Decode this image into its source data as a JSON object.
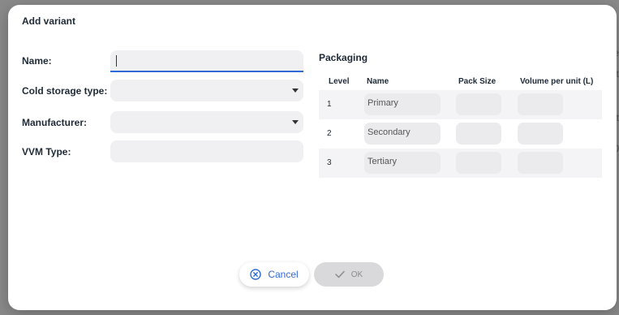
{
  "backdrop": {
    "right_fragments": [
      "e",
      "t",
      "st",
      "10"
    ]
  },
  "dialog": {
    "title": "Add variant"
  },
  "form": {
    "name_label": "Name:",
    "name_value": "",
    "cold_storage_label": "Cold storage type:",
    "cold_storage_value": "",
    "manufacturer_label": "Manufacturer:",
    "manufacturer_value": "",
    "vvm_label": "VVM Type:",
    "vvm_value": ""
  },
  "packaging": {
    "title": "Packaging",
    "columns": {
      "level": "Level",
      "name": "Name",
      "pack_size": "Pack Size",
      "volume": "Volume per unit (L)"
    },
    "rows": [
      {
        "level": "1",
        "name": "Primary",
        "pack_size": "",
        "volume": ""
      },
      {
        "level": "2",
        "name": "Secondary",
        "pack_size": "",
        "volume": ""
      },
      {
        "level": "3",
        "name": "Tertiary",
        "pack_size": "",
        "volume": ""
      }
    ]
  },
  "actions": {
    "cancel_label": "Cancel",
    "ok_label": "OK"
  },
  "colors": {
    "accent": "#2f6bd6",
    "field_bg": "#f0f0f2",
    "disabled_button": "#d9d9db"
  },
  "icons": {
    "cancel": "close-circle-icon",
    "ok": "check-icon",
    "dropdown": "chevron-down-icon"
  }
}
